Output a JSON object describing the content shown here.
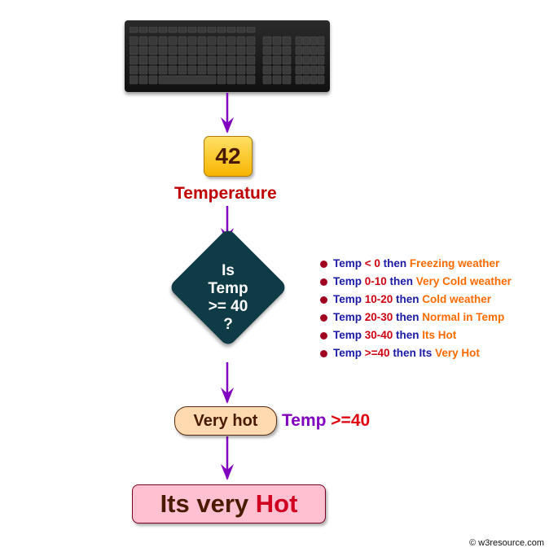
{
  "input": {
    "value": "42",
    "label": "Temperature"
  },
  "decision": {
    "lines": [
      "Is",
      "Temp",
      ">= 40",
      "?"
    ]
  },
  "legend": [
    [
      {
        "t": "Temp ",
        "c": "blue"
      },
      {
        "t": "< 0",
        "c": "red"
      },
      {
        "t": " then ",
        "c": "blue"
      },
      {
        "t": "Freezing weather",
        "c": "orange"
      }
    ],
    [
      {
        "t": "Temp ",
        "c": "blue"
      },
      {
        "t": "0-10",
        "c": "red"
      },
      {
        "t": " then ",
        "c": "blue"
      },
      {
        "t": "Very Cold weather",
        "c": "orange"
      }
    ],
    [
      {
        "t": "Temp ",
        "c": "blue"
      },
      {
        "t": "10-20",
        "c": "red"
      },
      {
        "t": " then ",
        "c": "blue"
      },
      {
        "t": "Cold weather",
        "c": "orange"
      }
    ],
    [
      {
        "t": "Temp ",
        "c": "blue"
      },
      {
        "t": "20-30",
        "c": "red"
      },
      {
        "t": " then ",
        "c": "blue"
      },
      {
        "t": "Normal in Temp",
        "c": "orange"
      }
    ],
    [
      {
        "t": "Temp ",
        "c": "blue"
      },
      {
        "t": "30-40",
        "c": "red"
      },
      {
        "t": " then ",
        "c": "blue"
      },
      {
        "t": "Its Hot",
        "c": "orange"
      }
    ],
    [
      {
        "t": "Temp ",
        "c": "blue"
      },
      {
        "t": ">=40",
        "c": "red"
      },
      {
        "t": " then Its ",
        "c": "blue"
      },
      {
        "t": "Very Hot",
        "c": "orange"
      }
    ]
  ],
  "branch": {
    "label": "Very hot",
    "cond_a": "Temp ",
    "cond_b": ">=40"
  },
  "result": {
    "text_a": "Its very ",
    "text_b": "Hot"
  },
  "copyright": "© w3resource.com",
  "colors": {
    "arrow": "#8000c0",
    "decision": "#0f3b47"
  }
}
